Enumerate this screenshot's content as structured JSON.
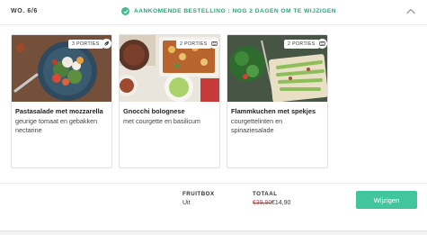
{
  "header": {
    "week": "WO. 6/6",
    "status": "AANKOMENDE BESTELLING : NOG 2 DAGEN OM TE WIJZIGEN",
    "status_icon": "check-circle-icon",
    "collapse_icon": "chevron-up-icon"
  },
  "recipes": [
    {
      "title": "Pastasalade met mozzarella",
      "subtitle": "geurige tomaat en gebakken nectarine",
      "portions": "3 PORTIES",
      "icon": "leaf-icon"
    },
    {
      "title": "Gnocchi bolognese",
      "subtitle": "met courgette en basilicum",
      "portions": "2 PORTIES",
      "icon": "oven-dish-icon"
    },
    {
      "title": "Flammkuchen met spekjes",
      "subtitle": "courgettelinten en spinaziesalade",
      "portions": "2 PORTIES",
      "icon": "oven-dish-icon"
    }
  ],
  "footer": {
    "fruit_label": "FRUITBOX",
    "fruit_value": "Uit",
    "total_label": "TOTAAL",
    "total_old": "€39,90",
    "total_new": "€14,90",
    "cta": "Wijzigen"
  },
  "colors": {
    "accent": "#43c59c",
    "status_text": "#2aa57b",
    "strike": "#d0453a"
  }
}
